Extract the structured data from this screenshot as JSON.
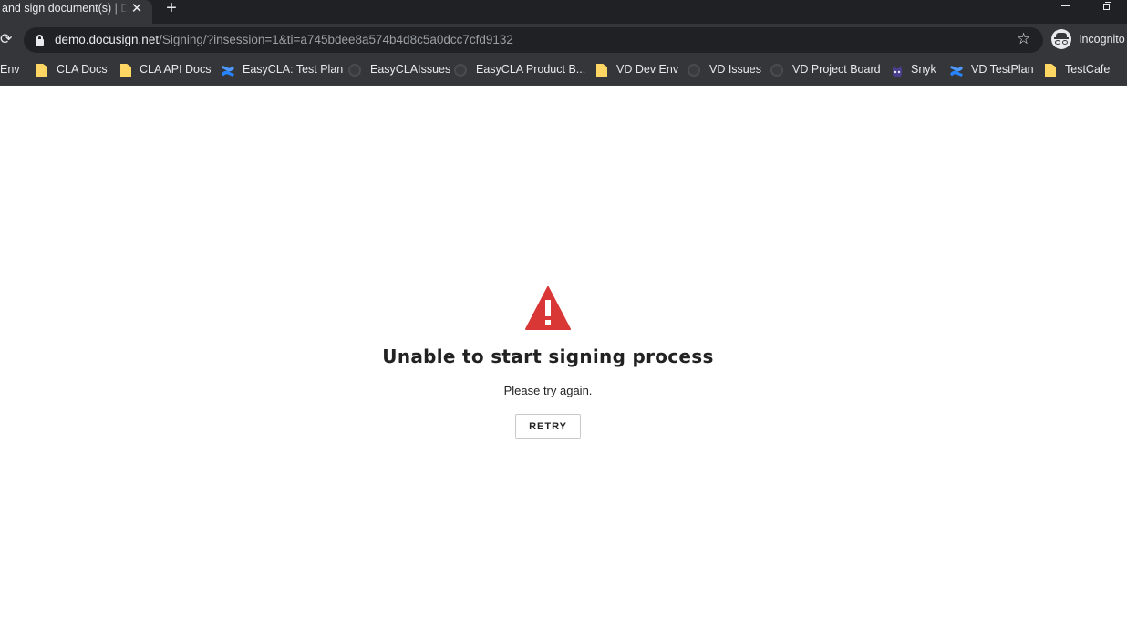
{
  "browser": {
    "tab": {
      "title": "and sign document(s) | DocuSign",
      "close_icon": "close-icon"
    },
    "new_tab_icon": "plus-icon",
    "address": {
      "host": "demo.docusign.net",
      "path": "/Signing/?insession=1&ti=a745bdee8a574b4d8c5a0dcc7cfd9132"
    },
    "profile_label": "Incognito",
    "bookmarks": [
      {
        "label": "Env",
        "icon": "none"
      },
      {
        "label": "CLA Docs",
        "icon": "folder-icon"
      },
      {
        "label": "CLA API Docs",
        "icon": "folder-icon"
      },
      {
        "label": "EasyCLA: Test Plan",
        "icon": "confluence-icon"
      },
      {
        "label": "EasyCLAIssues",
        "icon": "github-icon"
      },
      {
        "label": "EasyCLA Product B...",
        "icon": "github-icon"
      },
      {
        "label": "VD Dev Env",
        "icon": "folder-icon"
      },
      {
        "label": "VD Issues",
        "icon": "github-icon"
      },
      {
        "label": "VD Project Board",
        "icon": "github-icon"
      },
      {
        "label": "Snyk",
        "icon": "snyk-icon"
      },
      {
        "label": "VD TestPlan",
        "icon": "confluence-icon"
      },
      {
        "label": "TestCafe",
        "icon": "folder-icon"
      }
    ]
  },
  "error": {
    "icon": "warning-icon",
    "icon_color": "#d93636",
    "title": "Unable to start signing process",
    "message": "Please try again.",
    "retry_label": "RETRY"
  }
}
